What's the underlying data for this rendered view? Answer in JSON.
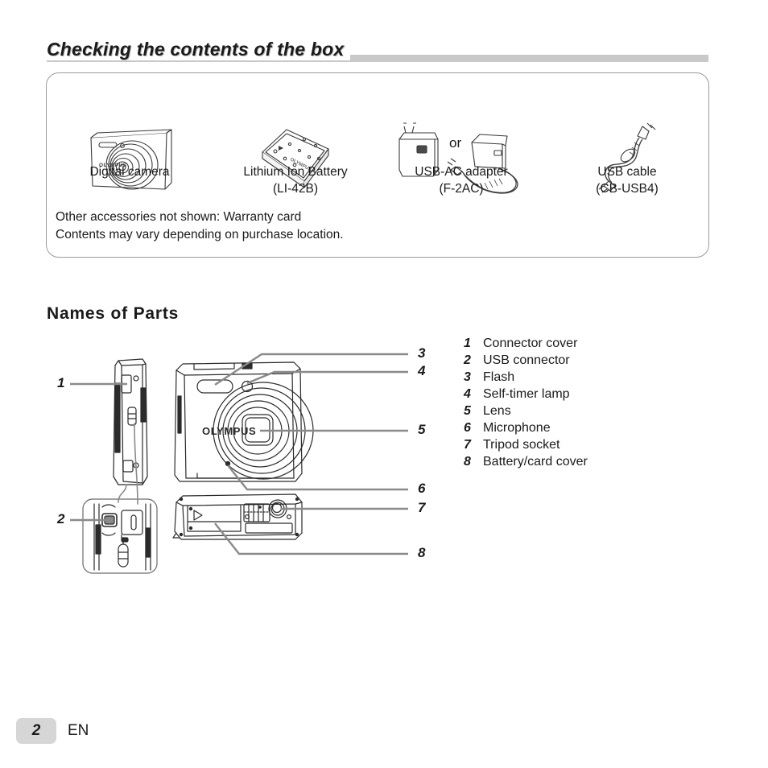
{
  "section": {
    "title": "Checking the contents of the box",
    "rule_color": "#c9c9c9"
  },
  "contents_box": {
    "items": [
      {
        "icon": "digital-camera-illustration",
        "label": "Digital camera",
        "sub": ""
      },
      {
        "icon": "lithium-ion-battery-illustration",
        "label": "Lithium Ion Battery",
        "sub": "(LI-42B)"
      },
      {
        "icon": "usb-ac-adapter-illustration",
        "label": "USB-AC adapter",
        "sub": "(F-2AC)"
      },
      {
        "icon": "usb-cable-illustration",
        "label": "USB cable",
        "sub": "(CB-USB4)"
      }
    ],
    "or_label": "or",
    "notes": [
      "Other accessories not shown: Warranty card",
      "Contents may vary depending on purchase location."
    ]
  },
  "parts": {
    "heading": "Names of Parts",
    "legend": [
      {
        "num": "1",
        "label": "Connector cover"
      },
      {
        "num": "2",
        "label": "USB connector"
      },
      {
        "num": "3",
        "label": "Flash"
      },
      {
        "num": "4",
        "label": "Self-timer lamp"
      },
      {
        "num": "5",
        "label": "Lens"
      },
      {
        "num": "6",
        "label": "Microphone"
      },
      {
        "num": "7",
        "label": "Tripod socket"
      },
      {
        "num": "8",
        "label": "Battery/card cover"
      }
    ],
    "callouts": [
      {
        "num": "1"
      },
      {
        "num": "2"
      },
      {
        "num": "3"
      },
      {
        "num": "4"
      },
      {
        "num": "5"
      },
      {
        "num": "6"
      },
      {
        "num": "7"
      },
      {
        "num": "8"
      }
    ],
    "brand_on_camera": "OLYMPUS",
    "leader_color": "#8a8a8a"
  },
  "footer": {
    "page_number": "2",
    "language": "EN",
    "badge_color": "#d6d6d6"
  }
}
